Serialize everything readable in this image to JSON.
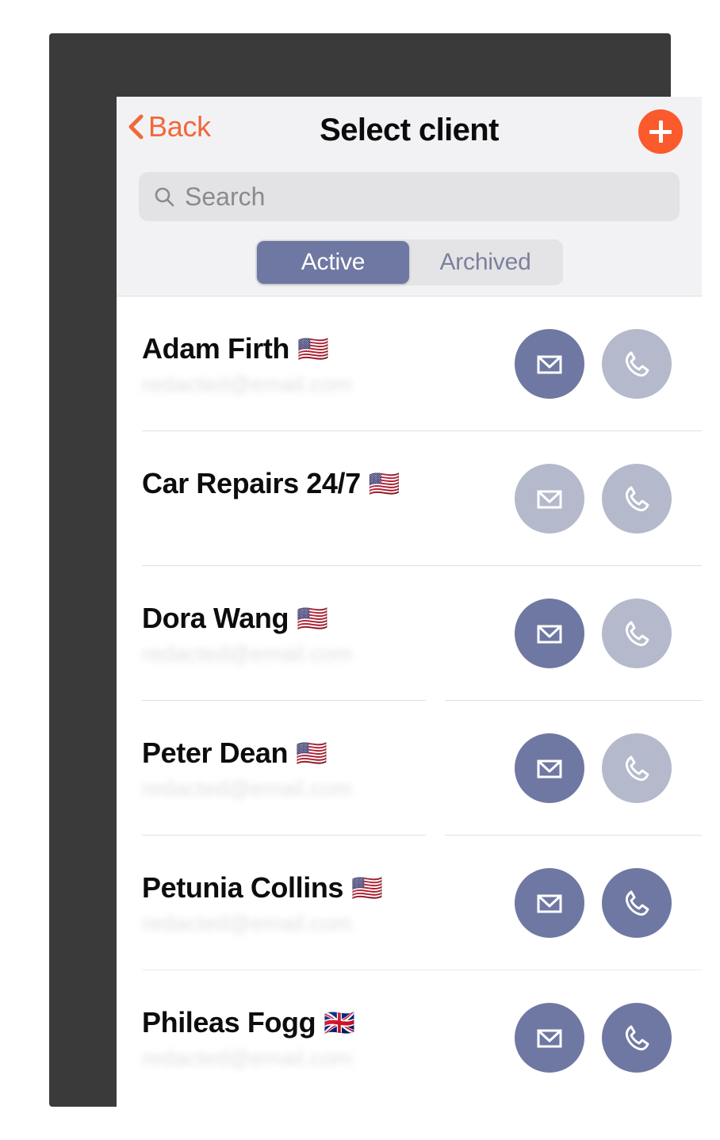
{
  "nav": {
    "back_label": "Back",
    "back_icon": "chevron-left-icon",
    "title": "Select client",
    "add_icon": "plus-icon",
    "accent_color": "#fa5a2c"
  },
  "search": {
    "icon": "search-icon",
    "placeholder": "Search",
    "value": ""
  },
  "segmented_control": {
    "selected": "Active",
    "selected_color": "#6f78a2",
    "options": [
      {
        "label": "Active",
        "selected": true
      },
      {
        "label": "Archived",
        "selected": false
      }
    ]
  },
  "list": {
    "action_enabled_color": "#6f78a2",
    "action_disabled_color": "#b4bacb",
    "rows": [
      {
        "name": "Adam Firth",
        "flag": "🇺🇸",
        "subtitle": "redacted@email.com",
        "subtitle_redacted": true,
        "mail_enabled": true,
        "phone_enabled": false
      },
      {
        "name": "Car Repairs  24/7",
        "flag": "🇺🇸",
        "subtitle": "",
        "subtitle_redacted": false,
        "mail_enabled": false,
        "phone_enabled": false
      },
      {
        "name": "Dora Wang",
        "flag": "🇺🇸",
        "subtitle": "redacted@email.com",
        "subtitle_redacted": true,
        "mail_enabled": true,
        "phone_enabled": false
      },
      {
        "name": "Peter Dean",
        "flag": "🇺🇸",
        "subtitle": "redacted@email.com",
        "subtitle_redacted": true,
        "mail_enabled": true,
        "phone_enabled": false
      },
      {
        "name": "Petunia Collins",
        "flag": "🇺🇸",
        "subtitle": "redacted@email.com",
        "subtitle_redacted": true,
        "mail_enabled": true,
        "phone_enabled": true
      },
      {
        "name": "Phileas Fogg",
        "flag": "🇬🇧",
        "subtitle": "redacted@email.com",
        "subtitle_redacted": true,
        "mail_enabled": true,
        "phone_enabled": true
      }
    ]
  }
}
